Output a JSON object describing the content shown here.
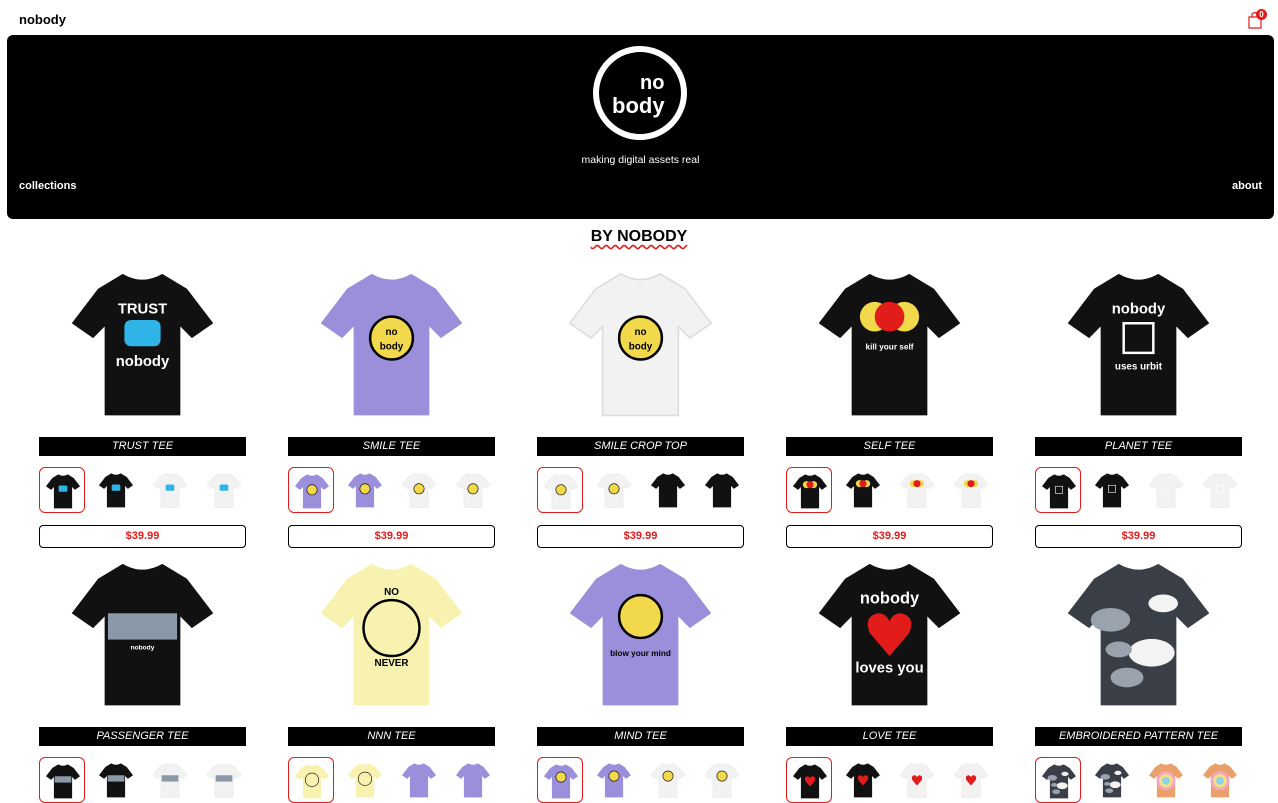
{
  "header": {
    "brand": "nobody",
    "cart_count": "0",
    "cart_icon": "shopping-bag-icon"
  },
  "hero": {
    "logo_text_1": "no",
    "logo_text_2": "body",
    "tagline": "making digital assets real",
    "nav_left": "collections",
    "nav_right": "about"
  },
  "section": {
    "title": "BY NOBODY"
  },
  "colors": {
    "accent": "#e21b1b",
    "black": "#000000",
    "purple": "#9b8fdc",
    "yellow": "#f8f2b0",
    "smiley": "#f2d84b"
  },
  "products": [
    {
      "title": "TRUST TEE",
      "price": "$39.99",
      "shirt": "black",
      "art": "trust",
      "tee_text_1": "TRUST",
      "tee_text_2": "nobody",
      "thumbs": [
        "black",
        "black",
        "white",
        "white"
      ]
    },
    {
      "title": "SMILE TEE",
      "price": "$39.99",
      "shirt": "purple",
      "art": "smile",
      "tee_text_1": "no",
      "tee_text_2": "body",
      "thumbs": [
        "purple",
        "purple",
        "white",
        "white"
      ]
    },
    {
      "title": "SMILE CROP TOP",
      "price": "$39.99",
      "shirt": "white",
      "art": "smile",
      "tee_text_1": "no",
      "tee_text_2": "body",
      "thumbs": [
        "white",
        "white",
        "black",
        "black"
      ]
    },
    {
      "title": "SELF TEE",
      "price": "$39.99",
      "shirt": "black",
      "art": "self",
      "tee_text_1": "kill your self",
      "tee_text_2": "",
      "thumbs": [
        "black",
        "black",
        "white",
        "white"
      ]
    },
    {
      "title": "PLANET TEE",
      "price": "$39.99",
      "shirt": "black",
      "art": "planet",
      "tee_text_1": "nobody",
      "tee_text_2": "uses urbit",
      "thumbs": [
        "black",
        "black",
        "white",
        "white"
      ]
    },
    {
      "title": "PASSENGER TEE",
      "price": "",
      "shirt": "black",
      "art": "passenger",
      "tee_text_1": "nobody",
      "tee_text_2": "",
      "thumbs": [
        "black",
        "black",
        "white",
        "white"
      ]
    },
    {
      "title": "NNN TEE",
      "price": "",
      "shirt": "yellow",
      "art": "nnn",
      "tee_text_1": "NO",
      "tee_text_2": "NEVER",
      "thumbs": [
        "yellow",
        "yellow",
        "purple",
        "purple"
      ]
    },
    {
      "title": "MIND TEE",
      "price": "",
      "shirt": "purple",
      "art": "mind",
      "tee_text_1": "blow your mind",
      "tee_text_2": "",
      "thumbs": [
        "purple",
        "purple",
        "white",
        "white"
      ]
    },
    {
      "title": "LOVE TEE",
      "price": "",
      "shirt": "black",
      "art": "love",
      "tee_text_1": "nobody",
      "tee_text_2": "loves you",
      "thumbs": [
        "black",
        "black",
        "white",
        "white"
      ]
    },
    {
      "title": "EMBROIDERED PATTERN TEE",
      "price": "",
      "shirt": "tiedye",
      "art": "none",
      "tee_text_1": "",
      "tee_text_2": "",
      "thumbs": [
        "tiedye",
        "tiedye",
        "rainbow",
        "rainbow"
      ]
    }
  ]
}
